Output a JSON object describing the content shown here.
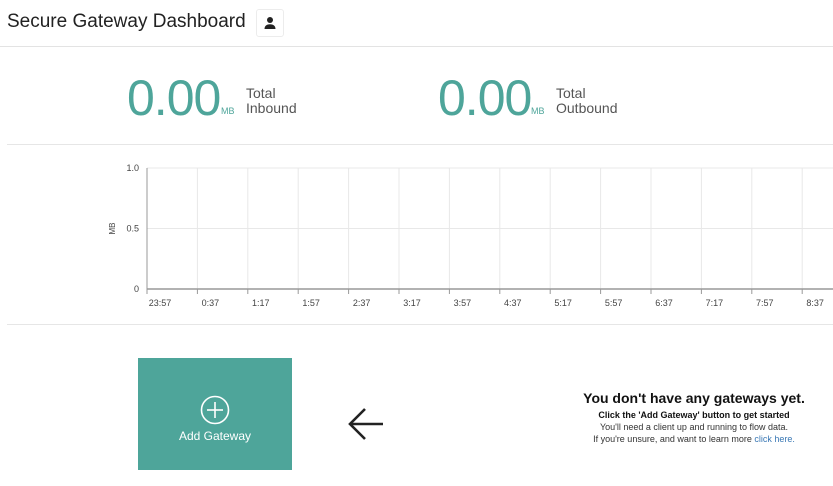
{
  "header": {
    "title": "Secure Gateway Dashboard",
    "user_icon": "person-icon"
  },
  "stats": {
    "inbound": {
      "value": "0.00",
      "unit": "MB",
      "label_line1": "Total",
      "label_line2": "Inbound"
    },
    "outbound": {
      "value": "0.00",
      "unit": "MB",
      "label_line1": "Total",
      "label_line2": "Outbound"
    }
  },
  "chart_data": {
    "type": "line",
    "ylabel": "MB",
    "ylim": [
      0,
      1.0
    ],
    "y_ticks": [
      "1.0",
      "0.5",
      "0"
    ],
    "x_ticks": [
      "23:57",
      "0:37",
      "1:17",
      "1:57",
      "2:37",
      "3:17",
      "3:57",
      "4:37",
      "5:17",
      "5:57",
      "6:37",
      "7:17",
      "7:57",
      "8:37"
    ],
    "series": [],
    "grid": true
  },
  "add_gateway": {
    "label": "Add Gateway",
    "icon": "plus-circle-icon"
  },
  "arrow_icon": "arrow-left-icon",
  "empty_state": {
    "heading": "You don't have any gateways yet.",
    "subheading": "Click the 'Add Gateway' button to get started",
    "line1": "You'll need a client up and running to flow data.",
    "line2_prefix": "If you're unsure, and want to learn more ",
    "link_text": "click here."
  },
  "colors": {
    "accent": "#4ea59a",
    "link": "#3a78b5"
  }
}
